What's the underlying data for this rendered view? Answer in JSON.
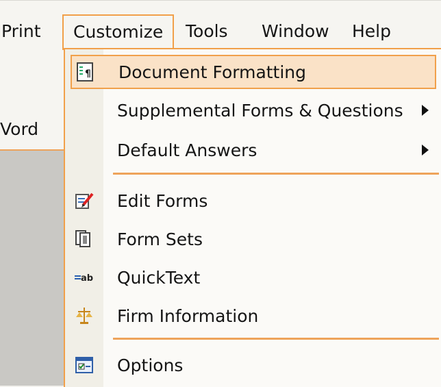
{
  "menubar": {
    "items": [
      {
        "label": "Print",
        "ul": "P"
      },
      {
        "label": "Customize",
        "ul": "z"
      },
      {
        "label": "Tools",
        "ul": "T"
      },
      {
        "label": "Window",
        "ul": "W"
      },
      {
        "label": "Help",
        "ul": "H"
      }
    ]
  },
  "left_panel": {
    "text": "Vord"
  },
  "menu": {
    "items": [
      {
        "label": "Document Formatting",
        "icon": "document-formatting-icon",
        "submenu": false
      },
      {
        "label": "Supplemental Forms & Questions",
        "icon": "",
        "submenu": true
      },
      {
        "label": "Default Answers",
        "icon": "",
        "submenu": true
      },
      {
        "label": "Edit Forms",
        "icon": "edit-forms-icon",
        "submenu": false
      },
      {
        "label": "Form Sets",
        "icon": "form-sets-icon",
        "submenu": false
      },
      {
        "label": "QuickText",
        "icon": "quicktext-icon",
        "submenu": false
      },
      {
        "label": "Firm Information",
        "icon": "firm-information-icon",
        "submenu": false
      },
      {
        "label": "Options",
        "icon": "options-icon",
        "submenu": false
      }
    ]
  },
  "colors": {
    "accent": "#f1a04a",
    "highlight": "#fae2c7"
  }
}
